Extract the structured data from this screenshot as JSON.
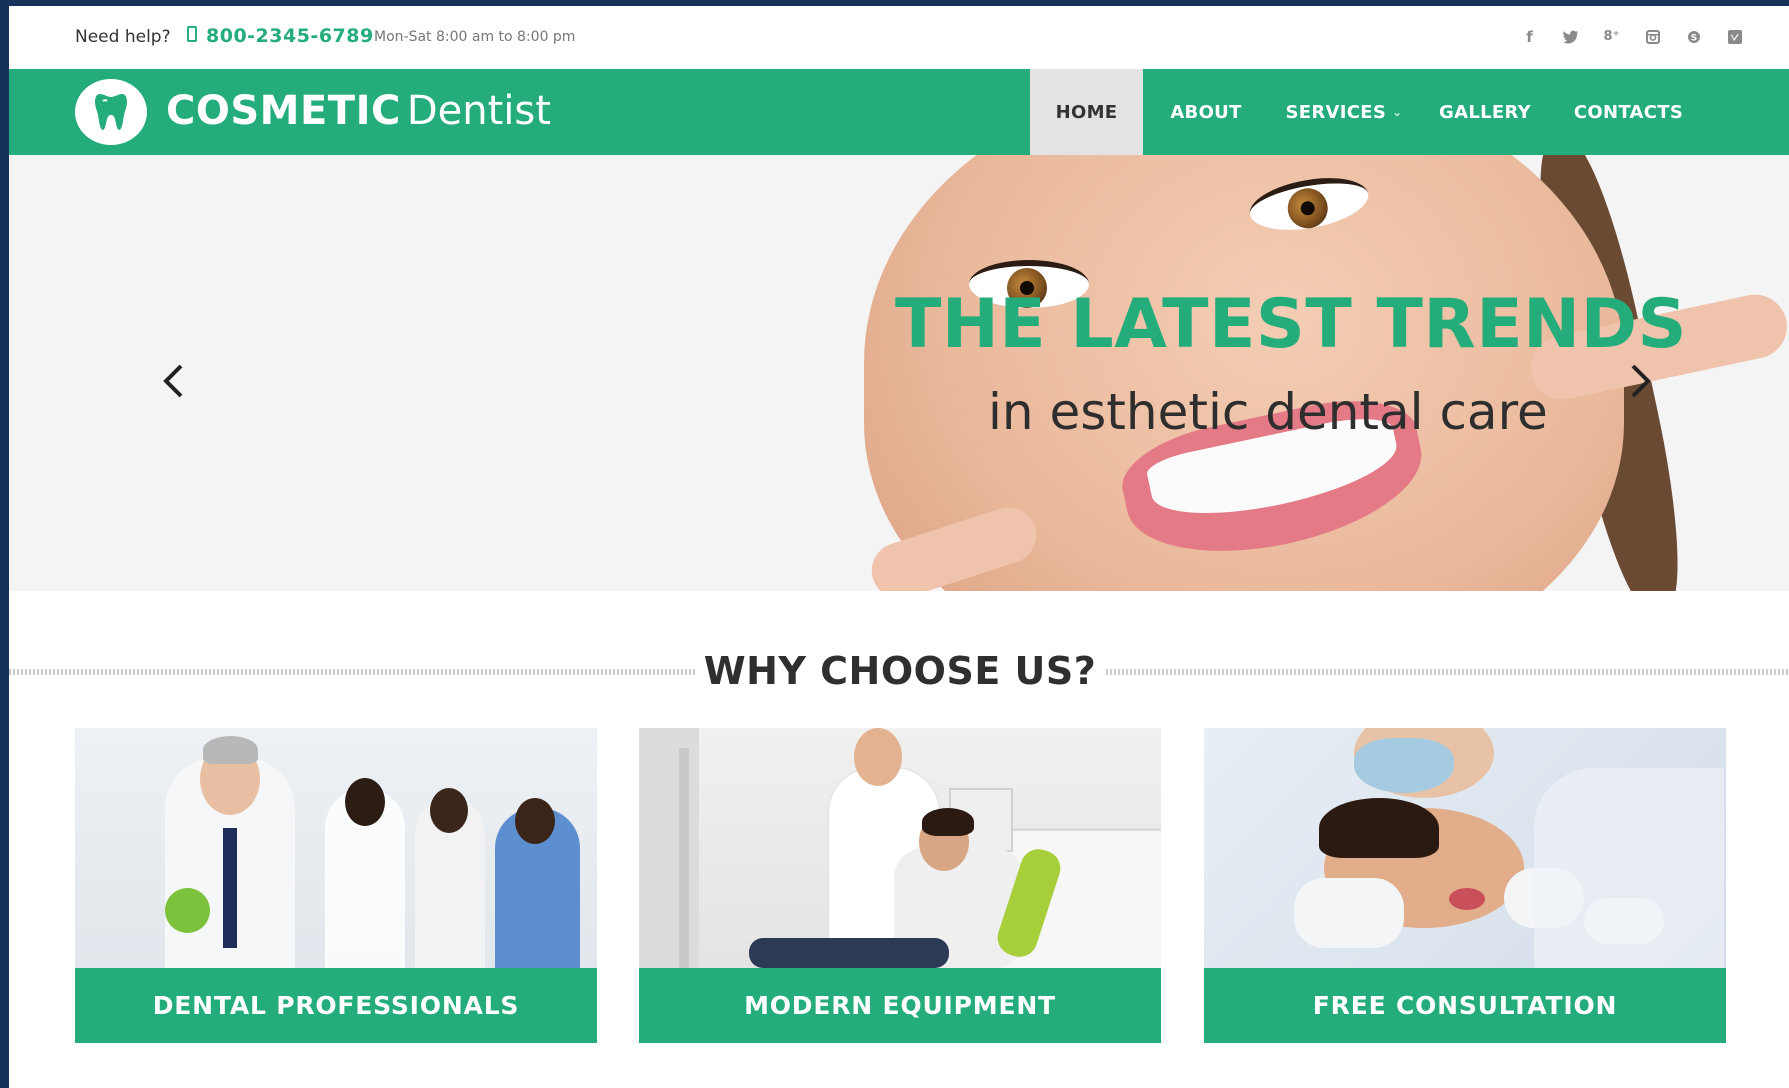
{
  "topbar": {
    "help_label": "Need help?",
    "phone_icon": "phone-icon",
    "phone": "800-2345-6789",
    "hours": "Mon-Sat 8:00 am to 8:00 pm",
    "social": [
      {
        "name": "facebook-icon",
        "glyph": "f"
      },
      {
        "name": "twitter-icon",
        "glyph": "t"
      },
      {
        "name": "google-plus-icon",
        "glyph": "g+"
      },
      {
        "name": "instagram-icon",
        "glyph": "ig"
      },
      {
        "name": "skype-icon",
        "glyph": "s"
      },
      {
        "name": "vimeo-icon",
        "glyph": "v"
      }
    ]
  },
  "header": {
    "logo_icon": "tooth-icon",
    "brand_bold": "COSMETIC",
    "brand_thin": "Dentist",
    "nav": {
      "home": "HOME",
      "about": "ABOUT",
      "services": "SERVICES",
      "gallery": "GALLERY",
      "contacts": "CONTACTS"
    }
  },
  "hero": {
    "title": "THE LATEST TRENDS",
    "subtitle": "in esthetic dental care",
    "prev_icon": "chevron-left-icon",
    "next_icon": "chevron-right-icon"
  },
  "section": {
    "title": "WHY CHOOSE US?"
  },
  "cards": [
    {
      "label": "DENTAL PROFESSIONALS"
    },
    {
      "label": "MODERN EQUIPMENT"
    },
    {
      "label": "FREE CONSULTATION"
    }
  ],
  "colors": {
    "accent": "#24ad7b",
    "nav_active_bg": "#e3e3e3",
    "frame": "#15325a"
  }
}
